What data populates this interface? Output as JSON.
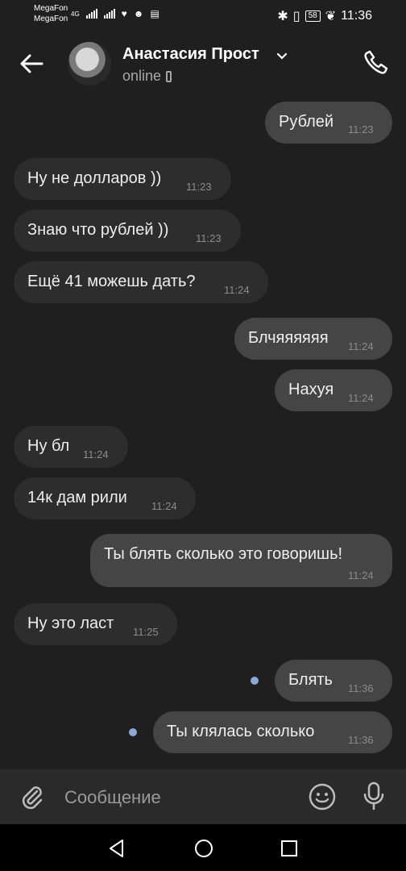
{
  "statusbar": {
    "carrier1": "MegaFon",
    "carrier2": "MegaFon",
    "network": "4G",
    "battery": "58",
    "time": "11:36"
  },
  "header": {
    "name": "Анастасия Прост",
    "status": "online"
  },
  "messages": [
    {
      "dir": "out",
      "text": "Рублей",
      "time": "11:23"
    },
    {
      "dir": "in",
      "text": "Ну не долларов ))",
      "time": "11:23"
    },
    {
      "dir": "in",
      "text": "Знаю что рублей ))",
      "time": "11:23"
    },
    {
      "dir": "in",
      "text": "Ещё 41 можешь дать?",
      "time": "11:24"
    },
    {
      "dir": "out",
      "text": "Блчяяяяяя",
      "time": "11:24"
    },
    {
      "dir": "out",
      "text": "Нахуя",
      "time": "11:24"
    },
    {
      "dir": "in",
      "text": "Ну бл",
      "time": "11:24"
    },
    {
      "dir": "in",
      "text": "14к дам рили",
      "time": "11:24"
    },
    {
      "dir": "out",
      "text": "Ты блять сколько это говоришь!",
      "time": "11:24"
    },
    {
      "dir": "in",
      "text": "Ну это ласт",
      "time": "11:25"
    },
    {
      "dir": "out",
      "text": "Блять",
      "time": "11:36",
      "unread": true
    },
    {
      "dir": "out",
      "text": "Ты клялась сколько",
      "time": "11:36",
      "unread": true
    }
  ],
  "composer": {
    "placeholder": "Сообщение"
  },
  "colors": {
    "background": "#1f1f1f",
    "incoming_bubble": "#2d2d2d",
    "outgoing_bubble": "#454545",
    "unread_dot": "#8aa9d8"
  },
  "icons": {
    "back": "arrow-left-icon",
    "dropdown": "chevron-down-icon",
    "call": "phone-icon",
    "attach": "paperclip-icon",
    "emoji": "smile-icon",
    "voice": "microphone-icon"
  }
}
